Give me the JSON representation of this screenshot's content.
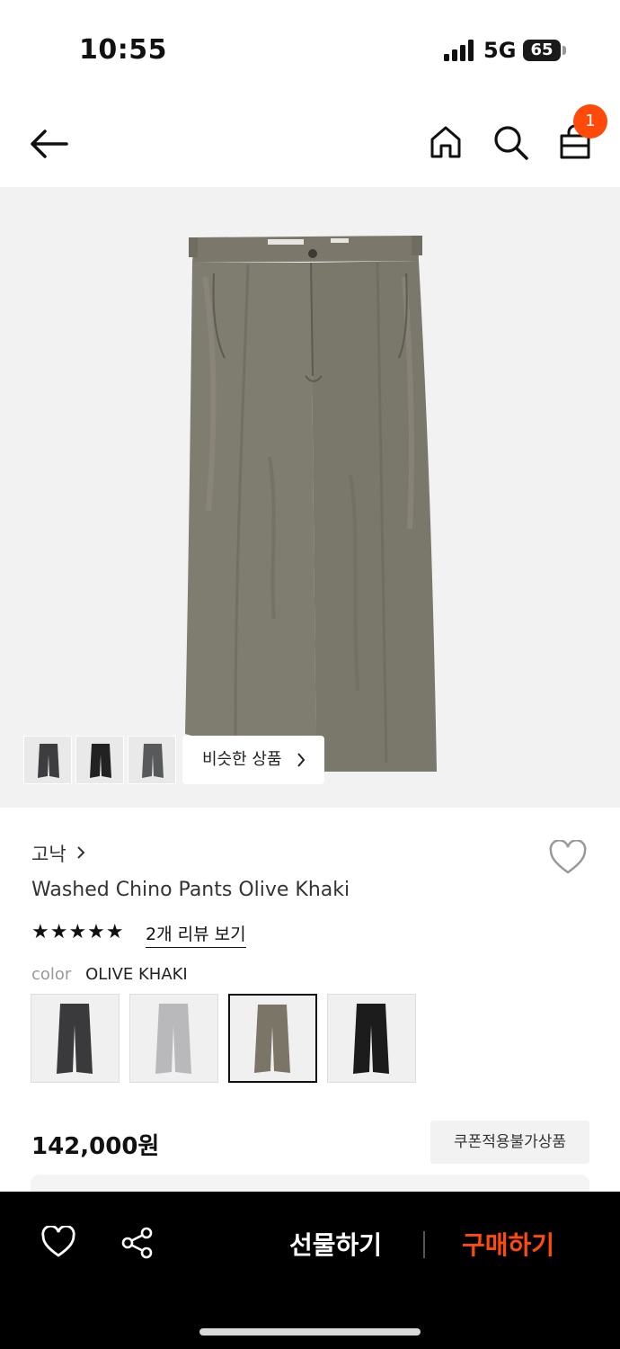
{
  "status_bar": {
    "time": "10:55",
    "network": "5G",
    "battery": "65"
  },
  "header": {
    "cart_count": "1"
  },
  "gallery": {
    "similar_label": "비슷한 상품",
    "thumbnail_count": 3
  },
  "product": {
    "brand": "고낙",
    "name": "Washed Chino Pants Olive Khaki",
    "rating_stars": "★★★★★",
    "review_link": "2개 리뷰 보기",
    "color_label": "color",
    "color_value": "OLIVE KHAKI",
    "swatches": [
      {
        "name": "charcoal",
        "color": "#3a3a3c"
      },
      {
        "name": "light-grey",
        "color": "#b9b9bb"
      },
      {
        "name": "olive-khaki",
        "color": "#7a7566",
        "selected": true
      },
      {
        "name": "black",
        "color": "#1c1c1c"
      }
    ],
    "price": "142,000원",
    "coupon_note": "쿠폰적용불가상품"
  },
  "bottom_bar": {
    "gift_label": "선물하기",
    "buy_label": "구매하기"
  },
  "colors": {
    "accent": "#ff4a0a",
    "pants_main": "#7d7a6e",
    "hero_bg": "#f2f2f2"
  }
}
